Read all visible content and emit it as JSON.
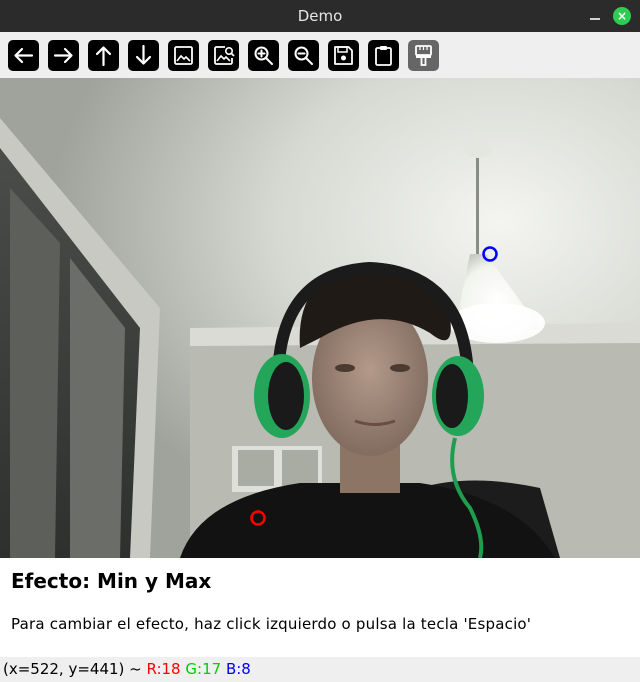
{
  "window": {
    "title": "Demo",
    "close_symbol": "×"
  },
  "toolbar": {
    "buttons": [
      {
        "name": "back-button",
        "icon": "arrow-left-icon"
      },
      {
        "name": "forward-button",
        "icon": "arrow-right-icon"
      },
      {
        "name": "up-button",
        "icon": "arrow-up-icon"
      },
      {
        "name": "down-button",
        "icon": "arrow-down-icon"
      },
      {
        "name": "image-button",
        "icon": "image-icon"
      },
      {
        "name": "image-search-button",
        "icon": "image-search-icon"
      },
      {
        "name": "zoom-in-button",
        "icon": "zoom-in-icon"
      },
      {
        "name": "zoom-out-button",
        "icon": "zoom-out-icon"
      },
      {
        "name": "save-button",
        "icon": "floppy-disk-icon"
      },
      {
        "name": "clipboard-button",
        "icon": "clipboard-icon"
      },
      {
        "name": "paint-brush-button",
        "icon": "paint-brush-icon"
      }
    ]
  },
  "viewer": {
    "min_marker_color": "#ff0000",
    "max_marker_color": "#0000ff"
  },
  "effect": {
    "title": "Efecto: Min y Max",
    "instructions": "Para cambiar el efecto, haz click izquierdo o pulsa la tecla 'Espacio'"
  },
  "status": {
    "coords": "(x=522, y=441) ~ ",
    "r": "R:18",
    "g": "G:17",
    "b": "B:8",
    "r_color": "#ff0000",
    "g_color": "#00cc00",
    "b_color": "#0000ff"
  }
}
